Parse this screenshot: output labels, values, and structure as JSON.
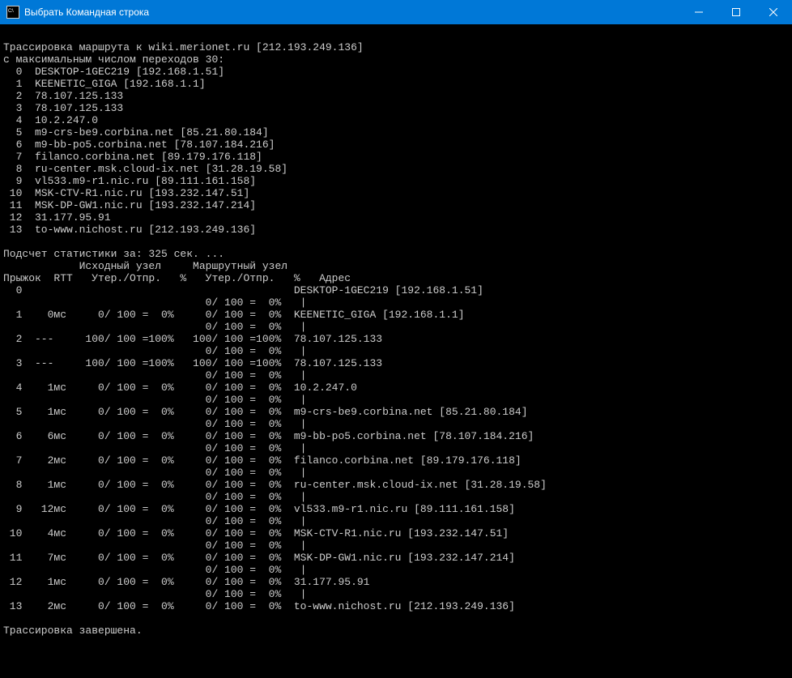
{
  "window": {
    "title": "Выбрать Командная строка"
  },
  "terminal": {
    "trace_line": "Трассировка маршрута к wiki.merionet.ru [212.193.249.136]",
    "max_hops_line": "с максимальным числом переходов 30:",
    "hops": [
      {
        "n": 0,
        "text": "DESKTOP-1GEC219 [192.168.1.51]"
      },
      {
        "n": 1,
        "text": "KEENETIC_GIGA [192.168.1.1]"
      },
      {
        "n": 2,
        "text": "78.107.125.133"
      },
      {
        "n": 3,
        "text": "78.107.125.133"
      },
      {
        "n": 4,
        "text": "10.2.247.0"
      },
      {
        "n": 5,
        "text": "m9-crs-be9.corbina.net [85.21.80.184]"
      },
      {
        "n": 6,
        "text": "m9-bb-po5.corbina.net [78.107.184.216]"
      },
      {
        "n": 7,
        "text": "filanco.corbina.net [89.179.176.118]"
      },
      {
        "n": 8,
        "text": "ru-center.msk.cloud-ix.net [31.28.19.58]"
      },
      {
        "n": 9,
        "text": "vl533.m9-r1.nic.ru [89.111.161.158]"
      },
      {
        "n": 10,
        "text": "MSK-CTV-R1.nic.ru [193.232.147.51]"
      },
      {
        "n": 11,
        "text": "MSK-DP-GW1.nic.ru [193.232.147.214]"
      },
      {
        "n": 12,
        "text": "31.177.95.91"
      },
      {
        "n": 13,
        "text": "to-www.nichost.ru [212.193.249.136]"
      }
    ],
    "stats_line": "Подсчет статистики за: 325 сек. ...",
    "header1": "            Исходный узел     Маршрутный узел",
    "header2": "Прыжок  RTT   Утер./Отпр.   %   Утер./Отпр.   %   Адрес",
    "stat_rows": [
      "  0                                           DESKTOP-1GEC219 [192.168.1.51]",
      "                                0/ 100 =  0%   |",
      "  1    0мс     0/ 100 =  0%     0/ 100 =  0%  KEENETIC_GIGA [192.168.1.1]",
      "                                0/ 100 =  0%   |",
      "  2  ---     100/ 100 =100%   100/ 100 =100%  78.107.125.133",
      "                                0/ 100 =  0%   |",
      "  3  ---     100/ 100 =100%   100/ 100 =100%  78.107.125.133",
      "                                0/ 100 =  0%   |",
      "  4    1мс     0/ 100 =  0%     0/ 100 =  0%  10.2.247.0",
      "                                0/ 100 =  0%   |",
      "  5    1мс     0/ 100 =  0%     0/ 100 =  0%  m9-crs-be9.corbina.net [85.21.80.184]",
      "                                0/ 100 =  0%   |",
      "  6    6мс     0/ 100 =  0%     0/ 100 =  0%  m9-bb-po5.corbina.net [78.107.184.216]",
      "                                0/ 100 =  0%   |",
      "  7    2мс     0/ 100 =  0%     0/ 100 =  0%  filanco.corbina.net [89.179.176.118]",
      "                                0/ 100 =  0%   |",
      "  8    1мс     0/ 100 =  0%     0/ 100 =  0%  ru-center.msk.cloud-ix.net [31.28.19.58]",
      "                                0/ 100 =  0%   |",
      "  9   12мс     0/ 100 =  0%     0/ 100 =  0%  vl533.m9-r1.nic.ru [89.111.161.158]",
      "                                0/ 100 =  0%   |",
      " 10    4мс     0/ 100 =  0%     0/ 100 =  0%  MSK-CTV-R1.nic.ru [193.232.147.51]",
      "                                0/ 100 =  0%   |",
      " 11    7мс     0/ 100 =  0%     0/ 100 =  0%  MSK-DP-GW1.nic.ru [193.232.147.214]",
      "                                0/ 100 =  0%   |",
      " 12    1мс     0/ 100 =  0%     0/ 100 =  0%  31.177.95.91",
      "                                0/ 100 =  0%   |",
      " 13    2мс     0/ 100 =  0%     0/ 100 =  0%  to-www.nichost.ru [212.193.249.136]"
    ],
    "done_line": "Трассировка завершена."
  }
}
